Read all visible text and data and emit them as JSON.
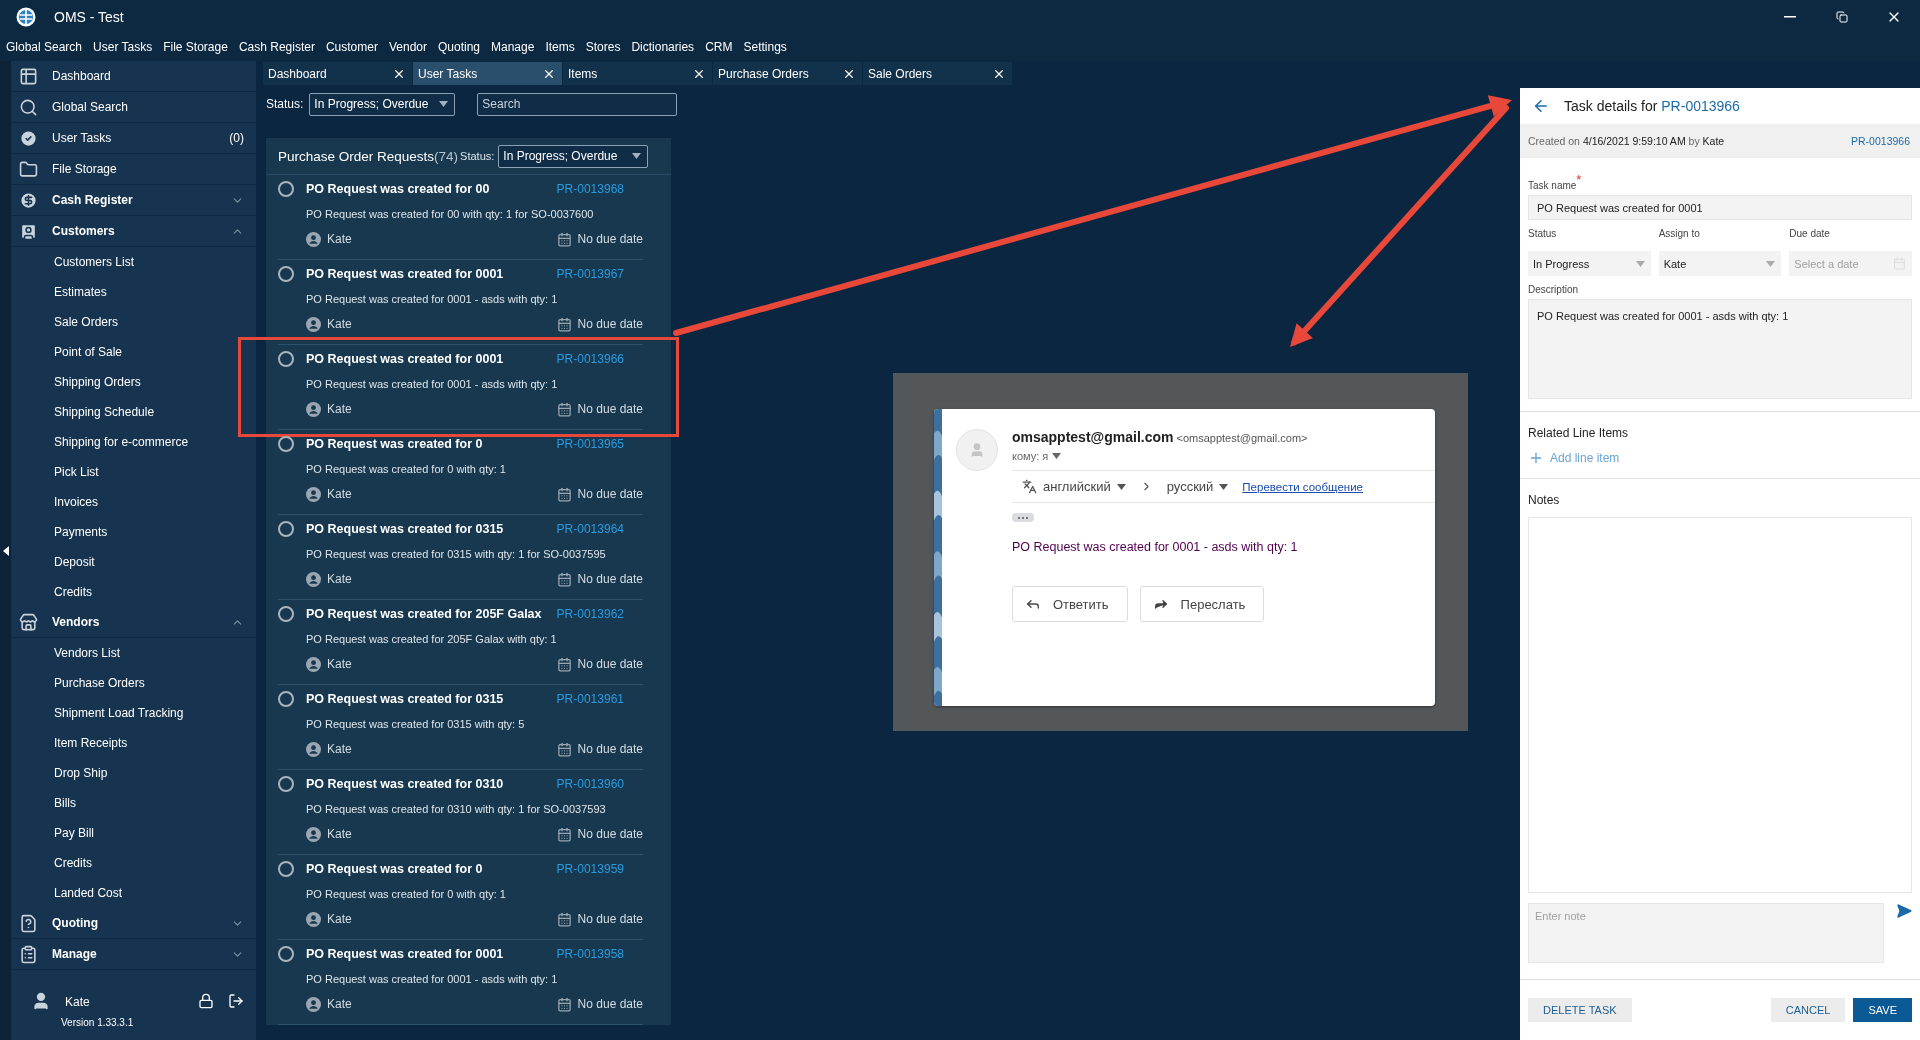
{
  "window": {
    "title": "OMS - Test"
  },
  "menu": [
    "Global Search",
    "User Tasks",
    "File Storage",
    "Cash Register",
    "Customer",
    "Vendor",
    "Quoting",
    "Manage",
    "Items",
    "Stores",
    "Dictionaries",
    "CRM",
    "Settings"
  ],
  "sidebar": {
    "items": [
      {
        "label": "Dashboard"
      },
      {
        "label": "Global Search"
      },
      {
        "label": "User Tasks",
        "badge": "(0)"
      },
      {
        "label": "File Storage"
      },
      {
        "label": "Cash Register",
        "expanded": false
      },
      {
        "label": "Customers",
        "expanded": true,
        "children": [
          "Customers List",
          "Estimates",
          "Sale Orders",
          "Point of Sale",
          "Shipping Orders",
          "Shipping Schedule",
          "Shipping for e-commerce",
          "Pick List",
          "Invoices",
          "Payments",
          "Deposit",
          "Credits"
        ]
      },
      {
        "label": "Vendors",
        "expanded": true,
        "children": [
          "Vendors List",
          "Purchase Orders",
          "Shipment Load Tracking",
          "Item Receipts",
          "Drop Ship",
          "Bills",
          "Pay Bill",
          "Credits",
          "Landed Cost"
        ]
      },
      {
        "label": "Quoting",
        "expanded": false
      },
      {
        "label": "Manage",
        "expanded": false
      }
    ],
    "user": "Kate",
    "version": "Version 1.33.3.1"
  },
  "tabs": [
    {
      "label": "Dashboard",
      "selected": false
    },
    {
      "label": "User Tasks",
      "selected": true
    },
    {
      "label": "Items",
      "selected": false
    },
    {
      "label": "Purchase Orders",
      "selected": false
    },
    {
      "label": "Sale Orders",
      "selected": false
    }
  ],
  "filter": {
    "status_label": "Status:",
    "status_value": "In Progress; Overdue",
    "search_placeholder": "Search"
  },
  "requests": {
    "title": "Purchase Order Requests",
    "count": "(74)",
    "status_label": "Status:",
    "status_value": "In Progress; Overdue",
    "items": [
      {
        "title": "PO Request was created for 00",
        "code": "PR-0013968",
        "description": "PO Request was created for 00 with qty: 1 for SO-0037600",
        "assignee": "Kate",
        "due": "No due date",
        "completed": false,
        "annotated": false
      },
      {
        "title": "PO Request was created for 0001",
        "code": "PR-0013967",
        "description": "PO Request was created for 0001 - asds with qty: 1",
        "assignee": "Kate",
        "due": "No due date",
        "completed": false,
        "annotated": false
      },
      {
        "title": "PO Request was created for 0001",
        "code": "PR-0013966",
        "description": "PO Request was created for 0001 - asds with qty: 1",
        "assignee": "Kate",
        "due": "No due date",
        "completed": false,
        "annotated": true
      },
      {
        "title": "PO Request was created for 0",
        "code": "PR-0013965",
        "description": "PO Request was created for 0 with qty: 1",
        "assignee": "Kate",
        "due": "No due date",
        "completed": false,
        "annotated": false
      },
      {
        "title": "PO Request was created for 0315",
        "code": "PR-0013964",
        "description": "PO Request was created for 0315 with qty: 1 for SO-0037595",
        "assignee": "Kate",
        "due": "No due date",
        "completed": false,
        "annotated": false
      },
      {
        "title": "PO Request was created for 205F Galax",
        "code": "PR-0013962",
        "description": "PO Request was created for 205F Galax with qty: 1",
        "assignee": "Kate",
        "due": "No due date",
        "completed": false,
        "annotated": false
      },
      {
        "title": "PO Request was created for 0315",
        "code": "PR-0013961",
        "description": "PO Request was created for 0315 with qty: 5",
        "assignee": "Kate",
        "due": "No due date",
        "completed": false,
        "annotated": false
      },
      {
        "title": "PO Request was created for 0310",
        "code": "PR-0013960",
        "description": "PO Request was created for 0310 with qty: 1 for SO-0037593",
        "assignee": "Kate",
        "due": "No due date",
        "completed": false,
        "annotated": false
      },
      {
        "title": "PO Request was created for 0",
        "code": "PR-0013959",
        "description": "PO Request was created for 0 with qty: 1",
        "assignee": "Kate",
        "due": "No due date",
        "completed": false,
        "annotated": false
      },
      {
        "title": "PO Request was created for 0001",
        "code": "PR-0013958",
        "description": "PO Request was created for 0001 - asds with qty: 1",
        "assignee": "Kate",
        "due": "No due date",
        "completed": false,
        "annotated": false
      }
    ]
  },
  "email": {
    "sender_name": "omsapptest@gmail.com",
    "sender_address": "<omsapptest@gmail.com>",
    "recipient": "кому: я",
    "source_language": "английский",
    "target_language": "русский",
    "translate_link": "Перевести сообщение",
    "body": "PO Request was created for 0001 - asds with qty: 1",
    "buttons": [
      "Ответить",
      "Переслать"
    ]
  },
  "task_panel": {
    "title": "Task details for",
    "code": "PR-0013966",
    "created": "Created on **4/16/2021 9:59:10 AM** by **Kate**",
    "created_code": "PR-0013966",
    "task_name_label": "Task name",
    "required_mark": "*",
    "task_name": "PO Request was created for 0001",
    "status_label": "Status",
    "status": "In Progress",
    "assign_label": "Assign to",
    "assignee": "Kate",
    "due_label": "Due date",
    "due_placeholder": "Select a date",
    "description_label": "Description",
    "description": "PO Request was created for 0001 - asds with qty: 1",
    "related_title": "Related Line Items",
    "add_line": "Add line item",
    "notes_title": "Notes",
    "note_placeholder": "Enter note",
    "delete_button": "DELETE TASK",
    "cancel_button": "CANCEL",
    "save_button": "SAVE"
  }
}
